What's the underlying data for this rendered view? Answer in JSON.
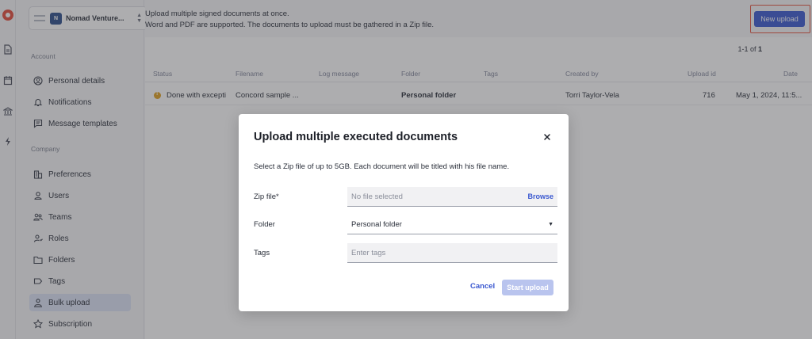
{
  "rail": {
    "icons": [
      "logo-icon",
      "document-icon",
      "calendar-icon",
      "bank-icon",
      "bolt-icon"
    ]
  },
  "org_switcher": {
    "avatar_initial": "N",
    "name": "Nomad Venture..."
  },
  "sidebar": {
    "account_label": "Account",
    "account_items": [
      {
        "label": "Personal details",
        "icon": "user-circle-icon"
      },
      {
        "label": "Notifications",
        "icon": "bell-icon"
      },
      {
        "label": "Message templates",
        "icon": "message-icon"
      }
    ],
    "company_label": "Company",
    "company_items": [
      {
        "label": "Preferences",
        "icon": "building-icon"
      },
      {
        "label": "Users",
        "icon": "user-icon"
      },
      {
        "label": "Teams",
        "icon": "team-icon"
      },
      {
        "label": "Roles",
        "icon": "role-icon"
      },
      {
        "label": "Folders",
        "icon": "folder-icon"
      },
      {
        "label": "Tags",
        "icon": "tag-icon"
      },
      {
        "label": "Bulk upload",
        "icon": "upload-icon",
        "active": true
      },
      {
        "label": "Subscription",
        "icon": "star-icon"
      }
    ]
  },
  "header": {
    "line1": "Upload multiple signed documents at once.",
    "line2": "Word and PDF are supported. The documents to upload must be gathered in a Zip file.",
    "new_upload_label": "New upload"
  },
  "table": {
    "pager_prefix": "1-1 of",
    "pager_total": "1",
    "columns": [
      "Status",
      "Filename",
      "Log message",
      "Folder",
      "Tags",
      "Created by",
      "Upload id",
      "Date"
    ],
    "rows": [
      {
        "status": "Done with excepti",
        "filename": "Concord sample ...",
        "log_message": "",
        "folder": "Personal folder",
        "tags": "",
        "created_by": "Torri Taylor-Vela",
        "upload_id": "716",
        "date": "May 1, 2024, 11:5..."
      }
    ]
  },
  "modal": {
    "title": "Upload multiple executed documents",
    "description": "Select a Zip file of up to 5GB. Each document will be titled with his file name.",
    "zip_label": "Zip file*",
    "zip_placeholder": "No file selected",
    "browse_label": "Browse",
    "folder_label": "Folder",
    "folder_value": "Personal folder",
    "tags_label": "Tags",
    "tags_placeholder": "Enter tags",
    "cancel_label": "Cancel",
    "start_label": "Start upload"
  },
  "colors": {
    "accent": "#3a58d0",
    "highlight_border": "#e5543f",
    "status_warning": "#e0a020",
    "active_nav_bg": "#dde3f6"
  }
}
